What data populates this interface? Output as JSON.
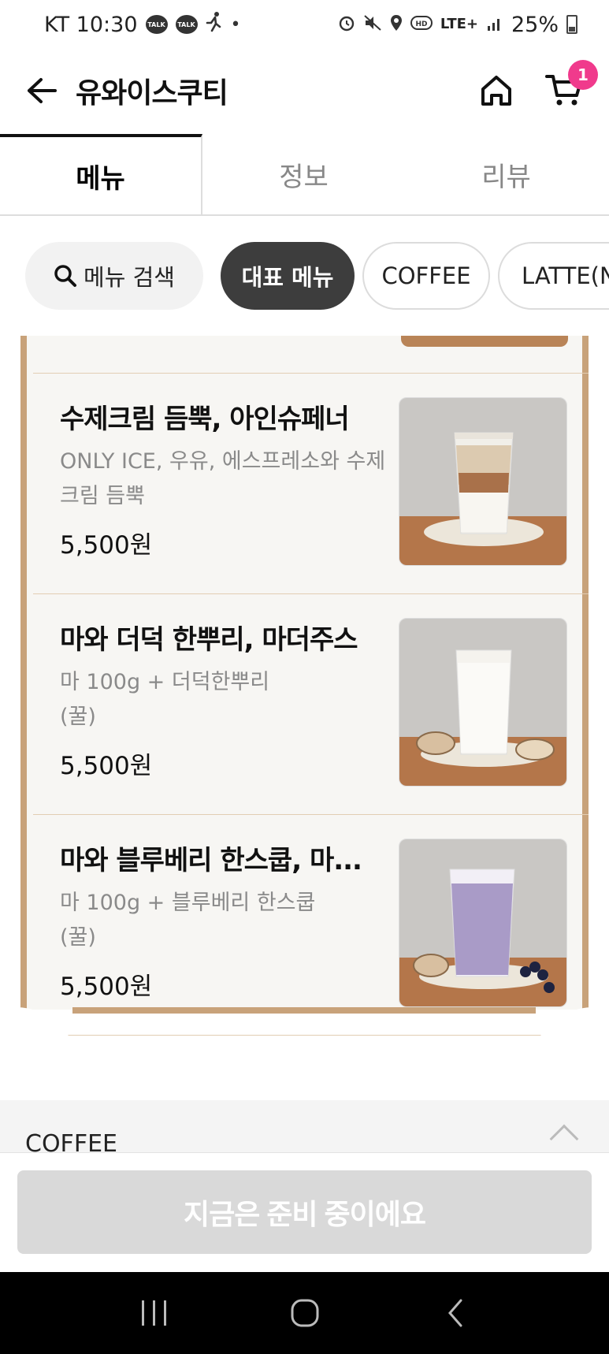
{
  "status_bar": {
    "carrier_time": "KT 10:30",
    "talk_badge": "TALK",
    "network": "LTE+",
    "battery": "25%",
    "icons": [
      "talk-icon",
      "talk-icon",
      "running-icon",
      "dot-icon",
      "alarm-icon",
      "mute-icon",
      "location-icon",
      "hd-icon",
      "lte-icon",
      "signal-icon",
      "battery-icon"
    ]
  },
  "header": {
    "title": "유와이스쿠티",
    "cart_count": "1"
  },
  "tabs": [
    {
      "label": "메뉴",
      "active": true
    },
    {
      "label": "정보",
      "active": false
    },
    {
      "label": "리뷰",
      "active": false
    }
  ],
  "chips": {
    "search_label": "메뉴 검색",
    "items": [
      "대표 메뉴",
      "COFFEE",
      "LATTE(N"
    ],
    "selected": "대표 메뉴"
  },
  "menu_items": [
    {
      "name": "수제크림 듬뿍, 아인슈페너",
      "desc": "ONLY ICE, 우유, 에스프레소와 수제크림 듬뿍",
      "price": "5,500원",
      "photo": "layered iced latte"
    },
    {
      "name": "마와 더덕 한뿌리, 마더주스",
      "desc": "마 100g + 더덕한뿌리\n(꿀)",
      "price": "5,500원",
      "photo": "white yam drink"
    },
    {
      "name": "마와 블루베리 한스쿱, 마...",
      "desc": "마 100g + 블루베리 한스쿱\n(꿀)",
      "price": "5,500원",
      "photo": "purple blueberry drink"
    }
  ],
  "category": {
    "title": "COFFEE"
  },
  "cta": {
    "label": "지금은 준비 중이에요"
  },
  "colors": {
    "accent_pink": "#f03a8c",
    "board_wood": "#c8a27a",
    "chip_selected": "#3d3d3d",
    "cta_disabled": "#d9d9d9"
  }
}
